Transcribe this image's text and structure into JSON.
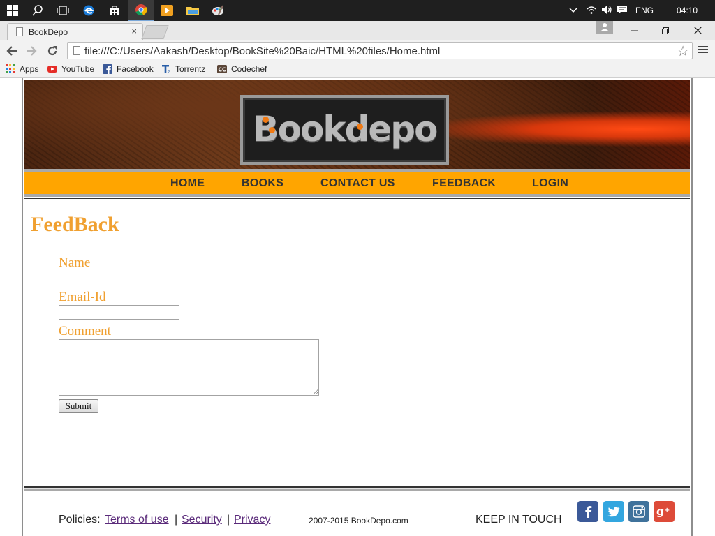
{
  "taskbar": {
    "tray_language": "ENG",
    "time": "04:10"
  },
  "browser": {
    "tab_title": "BookDepo",
    "tab_close": "×",
    "url": "file:///C:/Users/Aakash/Desktop/BookSite%20Baic/HTML%20files/Home.html",
    "bookmarks": [
      {
        "label": "Apps",
        "icon": "apps-grid-icon",
        "color": "#e53935"
      },
      {
        "label": "YouTube",
        "icon": "youtube-icon",
        "color": "#e52d27"
      },
      {
        "label": "Facebook",
        "icon": "facebook-icon",
        "color": "#3b5998"
      },
      {
        "label": "Torrentz",
        "icon": "torrentz-icon",
        "color": "#2a5fa8"
      },
      {
        "label": "Codechef",
        "icon": "codechef-icon",
        "color": "#5b4638"
      }
    ]
  },
  "site": {
    "logo_text": "Bookdepo",
    "nav": [
      "HOME",
      "BOOKS",
      "CONTACT US",
      "FEEDBACK",
      "LOGIN"
    ],
    "nav_color": "#ffa500",
    "accent_color": "#f0a030",
    "form": {
      "title": "FeedBack",
      "name_label": "Name",
      "email_label": "Email-Id",
      "comment_label": "Comment",
      "submit_label": "Submit"
    },
    "footer": {
      "policies_label": "Policies:",
      "links": [
        "Terms of use",
        "Security",
        "Privacy"
      ],
      "separator": "|",
      "copyright": "2007-2015 BookDepo.com",
      "keep_in_touch": "KEEP IN TOUCH",
      "social": [
        {
          "name": "facebook-icon",
          "glyph": "f",
          "color": "#3b5998"
        },
        {
          "name": "twitter-icon",
          "glyph": "t",
          "color": "#33a6df"
        },
        {
          "name": "instagram-icon",
          "glyph": "◙",
          "color": "#3f729b"
        },
        {
          "name": "google-plus-icon",
          "glyph": "g+",
          "color": "#dd4b39"
        }
      ]
    }
  }
}
